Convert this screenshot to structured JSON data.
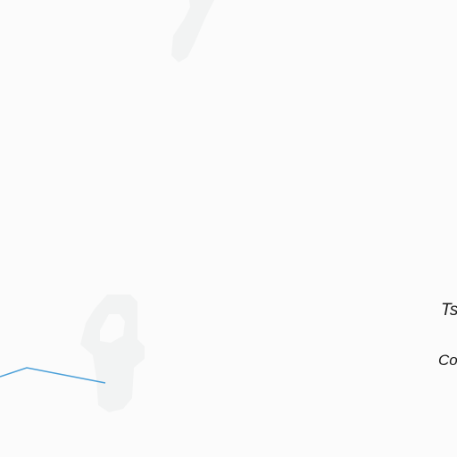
{
  "map": {
    "background_color": "#fbfbfb",
    "land_feature_color": "#f2f3f3",
    "river_color": "#4a9fd8",
    "labels": {
      "place_1": "Ts",
      "place_2": "Co"
    }
  }
}
